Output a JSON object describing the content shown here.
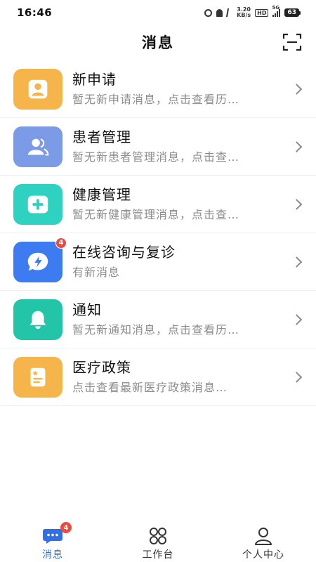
{
  "status_bar": {
    "time": "16:46",
    "net_speed_value": "3.20",
    "net_speed_unit": "KB/s",
    "hd_label": "HD",
    "network_label": "5G",
    "battery": "63"
  },
  "header": {
    "title": "消息",
    "scan_icon": "scan-icon"
  },
  "messages": [
    {
      "title": "新申请",
      "subtitle": "暂无新申请消息，点击查看历…",
      "icon": "person-icon",
      "color": "#f5b54a",
      "badge": ""
    },
    {
      "title": "患者管理",
      "subtitle": "暂无新患者管理消息，点击查…",
      "icon": "group-icon",
      "color": "#7c9be6",
      "badge": ""
    },
    {
      "title": "健康管理",
      "subtitle": "暂无新健康管理消息，点击查…",
      "icon": "medical-plus-icon",
      "color": "#2fd1c0",
      "badge": ""
    },
    {
      "title": "在线咨询与复诊",
      "subtitle": "有新消息",
      "icon": "chat-bolt-icon",
      "color": "#3d7bf0",
      "badge": "4"
    },
    {
      "title": "通知",
      "subtitle": "暂无新通知消息，点击查看历…",
      "icon": "bell-icon",
      "color": "#22c5a8",
      "badge": ""
    },
    {
      "title": "医疗政策",
      "subtitle": "点击查看最新医疗政策消息…",
      "icon": "document-star-icon",
      "color": "#f5b54a",
      "badge": ""
    }
  ],
  "tabs": [
    {
      "label": "消息",
      "icon": "chat-icon",
      "active": true,
      "badge": "4"
    },
    {
      "label": "工作台",
      "icon": "grid-icon",
      "active": false,
      "badge": ""
    },
    {
      "label": "个人中心",
      "icon": "user-icon",
      "active": false,
      "badge": ""
    }
  ],
  "colors": {
    "accent": "#2f6fe8",
    "badge": "#f04a3e"
  }
}
